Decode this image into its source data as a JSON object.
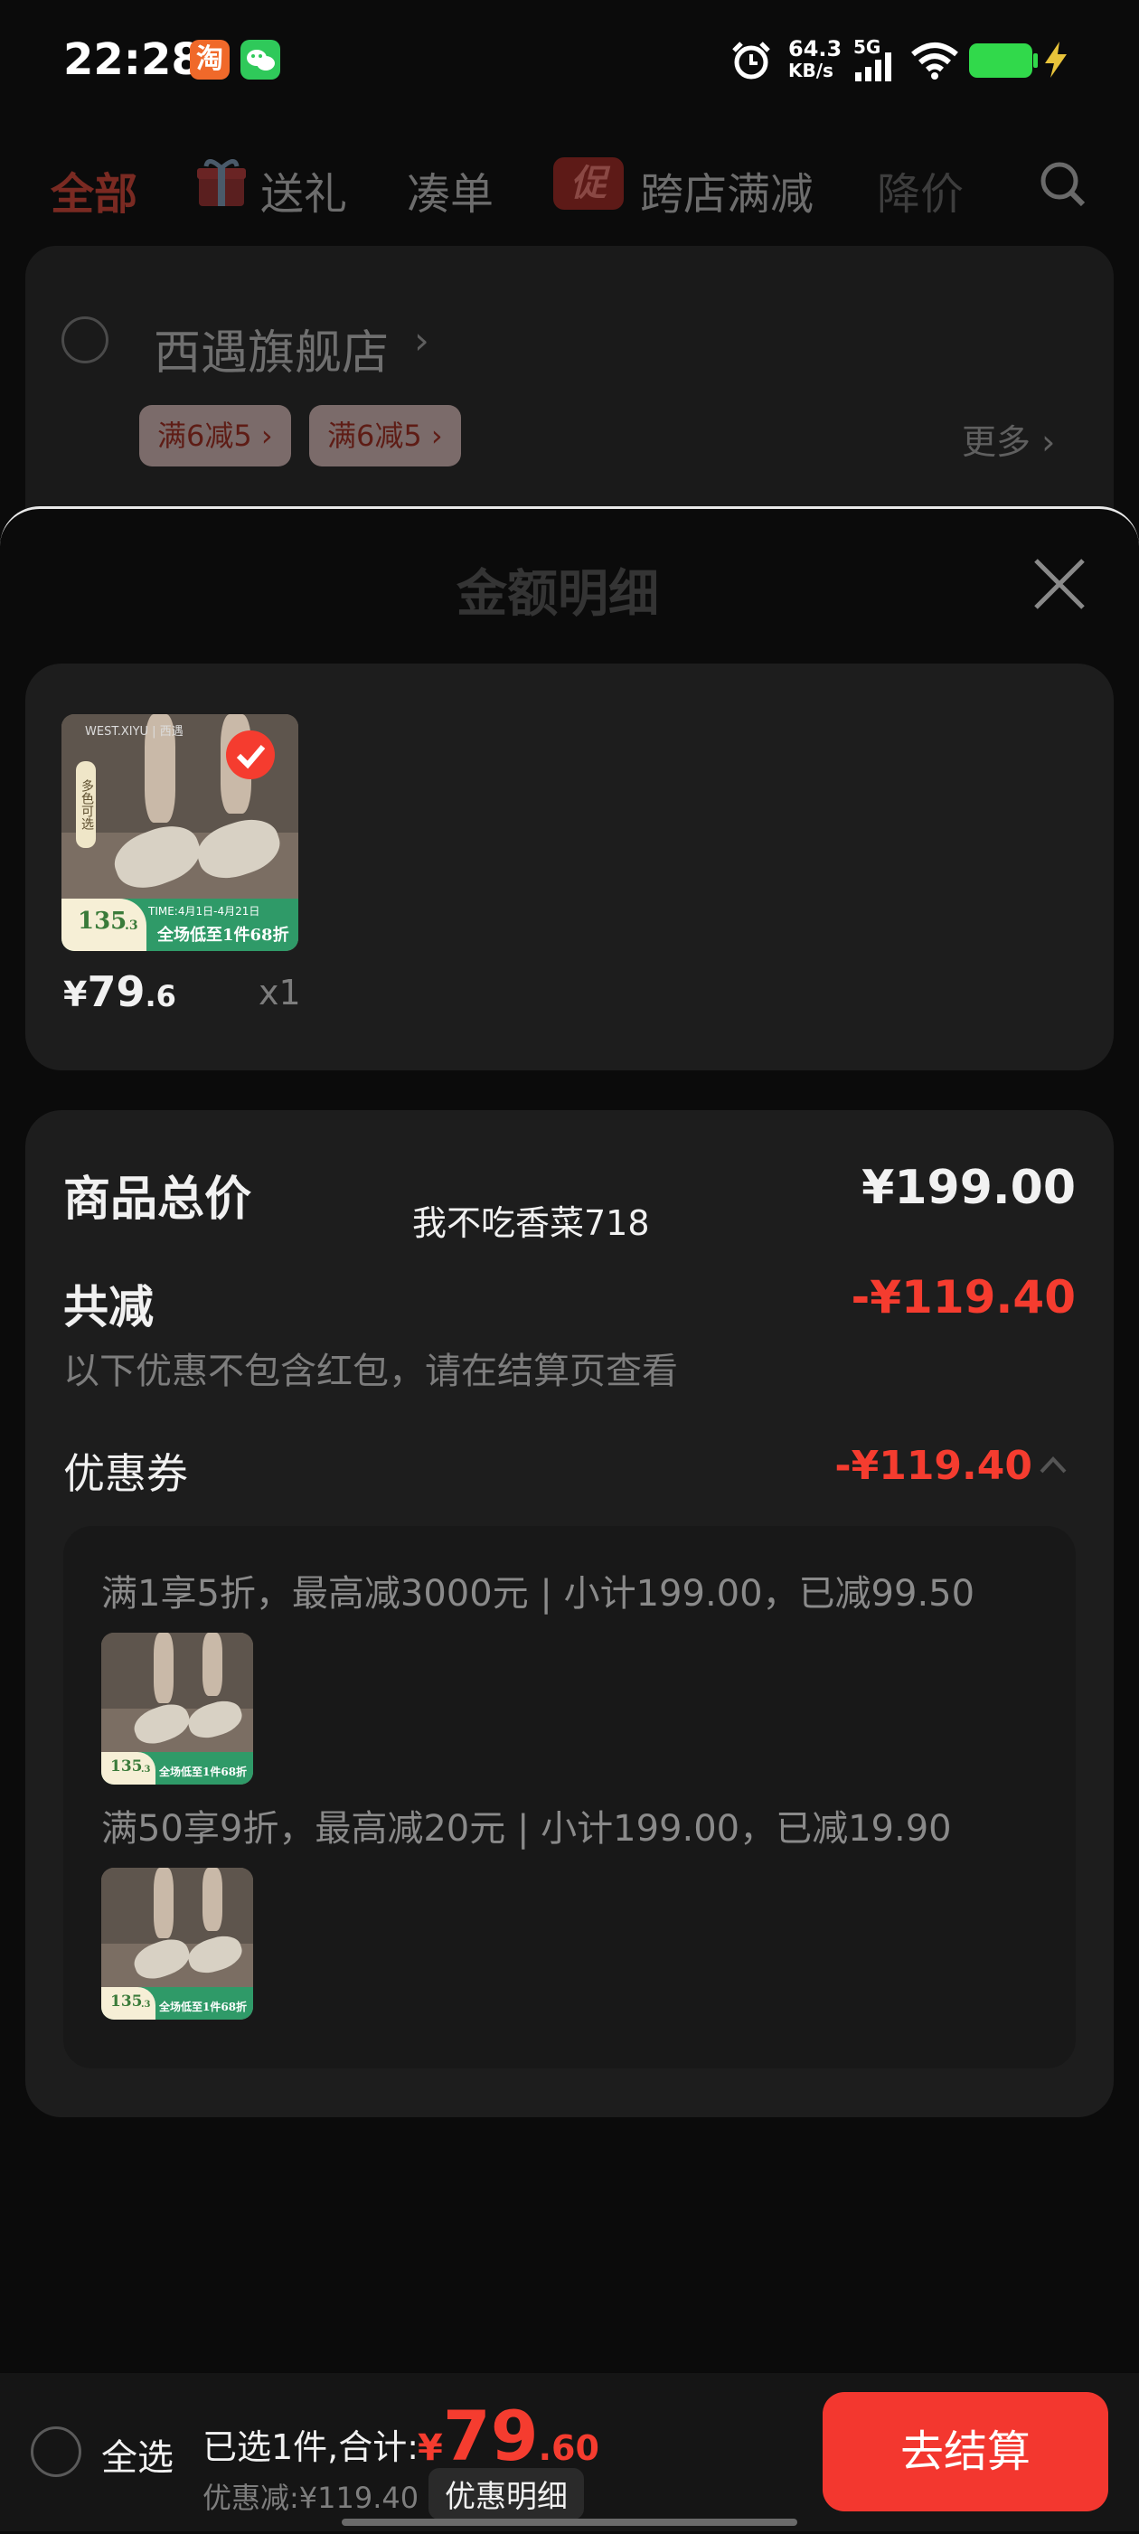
{
  "status_bar": {
    "time": "22:28",
    "taobao_icon": "淘",
    "wechat_icon": "wechat-icon",
    "network_speed_value": "64.3",
    "network_speed_unit": "KB/s",
    "network_type": "5G"
  },
  "tabs": [
    {
      "label": "全部"
    },
    {
      "label": "送礼"
    },
    {
      "label": "凑单"
    },
    {
      "label": "跨店满减",
      "badge": "促"
    },
    {
      "label": "降价"
    }
  ],
  "store": {
    "name": "西遇旗舰店",
    "chevron": "›",
    "promos": [
      "满6减5 ›",
      "满6减5 ›"
    ],
    "more": "更多 ›"
  },
  "sheet": {
    "title": "金额明细",
    "product": {
      "price_symbol": "¥",
      "price_int": "79",
      "price_dec": ".6",
      "qty": "x1",
      "thumb_price_big": "135",
      "thumb_price_small": ".3",
      "thumb_banner": "全场低至1件68折",
      "thumb_time": "TIME:4月1日-4月21日",
      "thumb_brand": "WEST.XIYU | 西遇",
      "thumb_side_tag": "多色可选"
    },
    "summary": {
      "total_label": "商品总价",
      "total_value": "¥199.00",
      "watermark": "我不吃香菜718",
      "discount_label": "共减",
      "discount_value": "-¥119.40",
      "note": "以下优惠不包含红包，请在结算页查看",
      "coupon_label": "优惠券",
      "coupon_value": "-¥119.40",
      "coupon_caret": "^",
      "coupons": [
        {
          "text": "满1享5折，最高减3000元 | 小计199.00，已减99.50",
          "thumb_price": "135",
          "thumb_price_small": ".3",
          "thumb_banner": "全场低至1件68折"
        },
        {
          "text": "满50享9折，最高减20元 | 小计199.00，已减19.90",
          "thumb_price": "135",
          "thumb_price_small": ".3",
          "thumb_banner": "全场低至1件68折"
        }
      ]
    }
  },
  "bottom_bar": {
    "select_all": "全选",
    "selected_text": "已选1件,合计:",
    "total_symbol": "¥",
    "total_int": "79",
    "total_dec": ".60",
    "discount_text": "优惠减:¥119.40",
    "detail_link": "优惠明细",
    "checkout": "去结算"
  },
  "colors": {
    "accent_red": "#f53c2f",
    "background": "#0b0b0b",
    "card": "#1d1d1d"
  }
}
